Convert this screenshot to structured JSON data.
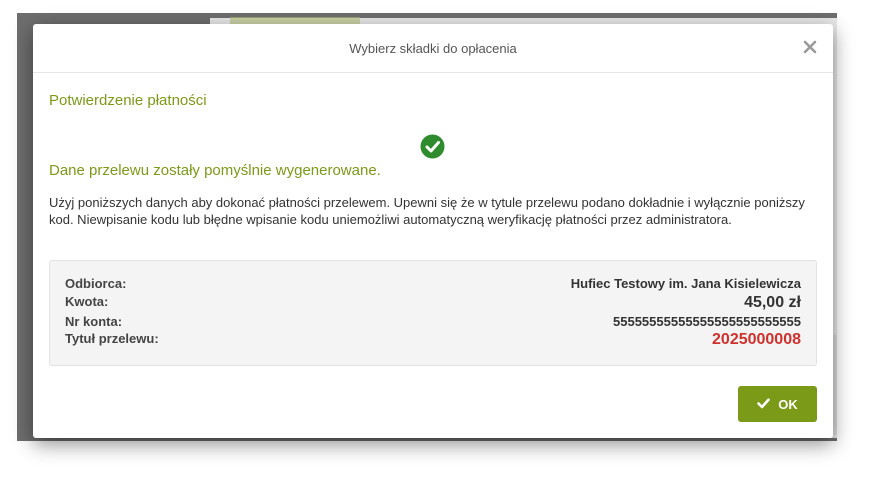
{
  "modal": {
    "title": "Wybierz składki do opłacenia",
    "close_icon": "close-icon"
  },
  "confirmation": {
    "section_title": "Potwierdzenie płatności",
    "success_icon": "check-circle-icon",
    "success_message": "Dane przelewu zostały pomyślnie wygenerowane.",
    "instructions": "Użyj poniższych danych aby dokonać płatności przelewem. Upewni się że w tytule przelewu podano dokładnie i wyłącznie poniższy kod. Niewpisanie kodu lub błędne wpisanie kodu uniemożliwi automatyczną weryfikację płatności przez administratora."
  },
  "details": {
    "recipient_label": "Odbiorca:",
    "recipient_value": "Hufiec Testowy im. Jana Kisielewicza",
    "amount_label": "Kwota:",
    "amount_value": "45,00 zł",
    "account_label": "Nr konta:",
    "account_value": "55555555555555555555555555",
    "title_label": "Tytuł przelewu:",
    "title_value": "2025000008"
  },
  "actions": {
    "ok_label": "OK",
    "ok_icon": "check-icon"
  },
  "colors": {
    "accent": "#7b9a18",
    "code": "#d0312d",
    "success_icon": "#2e8b2e"
  }
}
